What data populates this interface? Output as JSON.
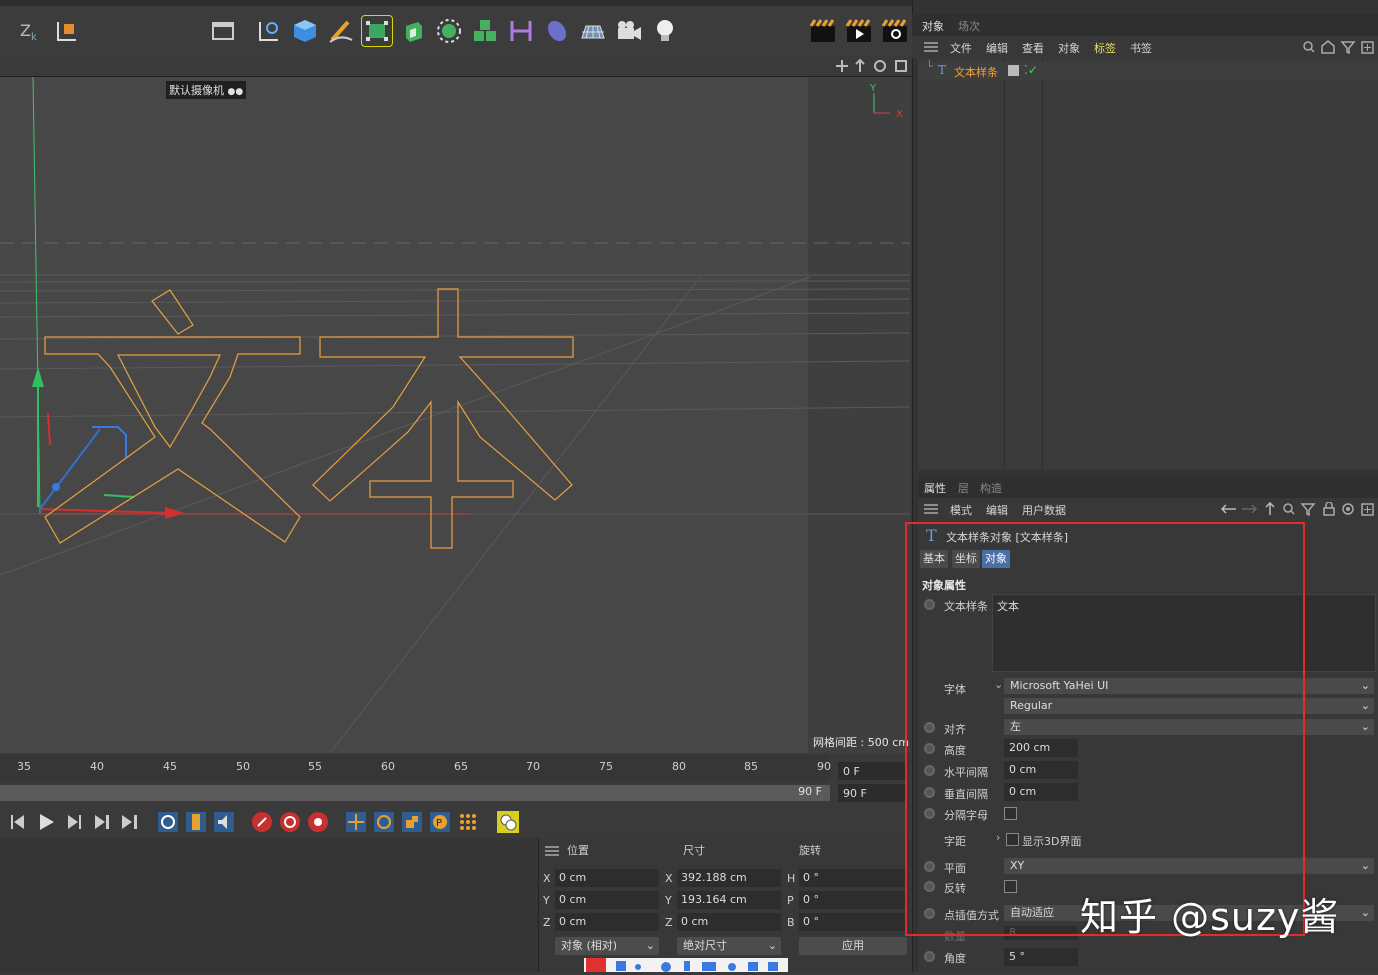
{
  "viewport": {
    "camera_label": "默认摄像机",
    "grid_spacing": "网格间距 : 500 cm",
    "axis_y": "Y",
    "axis_x": "X",
    "spline_text": "文本"
  },
  "timeline": {
    "ticks": [
      "35",
      "40",
      "45",
      "50",
      "55",
      "60",
      "65",
      "70",
      "75",
      "80",
      "85",
      "90"
    ],
    "current_frame": "0 F",
    "end_frame": "90 F",
    "end_field": "90 F",
    "scrub_end_label": "90 F"
  },
  "coords": {
    "headers": {
      "position": "位置",
      "size": "尺寸",
      "rotation": "旋转"
    },
    "rows": [
      {
        "axis": "X",
        "pos": "0 cm",
        "size_axis": "X",
        "size": "392.188 cm",
        "rot_axis": "H",
        "rot": "0 °"
      },
      {
        "axis": "Y",
        "pos": "0 cm",
        "size_axis": "Y",
        "size": "193.164 cm",
        "rot_axis": "P",
        "rot": "0 °"
      },
      {
        "axis": "Z",
        "pos": "0 cm",
        "size_axis": "Z",
        "size": "0 cm",
        "rot_axis": "B",
        "rot": "0 °"
      }
    ],
    "mode_dropdown": "对象 (相对)",
    "size_dropdown": "绝对尺寸",
    "apply_button": "应用"
  },
  "object_manager": {
    "tabs": [
      "对象",
      "场次"
    ],
    "menu": [
      "文件",
      "编辑",
      "查看",
      "对象",
      "标签",
      "书签"
    ],
    "items": [
      {
        "name": "文本样条"
      }
    ]
  },
  "attributes": {
    "tabs": [
      "属性",
      "层",
      "构造"
    ],
    "menu": [
      "模式",
      "编辑",
      "用户数据"
    ],
    "object_title": "文本样条对象 [文本样条]",
    "sub_tabs": [
      "基本",
      "坐标",
      "对象"
    ],
    "section_title": "对象属性",
    "text_label": "文本样条",
    "text_value": "文本",
    "font_label": "字体",
    "font_value": "Microsoft YaHei UI",
    "font_style": "Regular",
    "align_label": "对齐",
    "align_value": "左",
    "height_label": "高度",
    "height_value": "200 cm",
    "hspacing_label": "水平间隔",
    "hspacing_value": "0 cm",
    "vspacing_label": "垂直间隔",
    "vspacing_value": "0 cm",
    "separate_label": "分隔字母",
    "kerning_label": "字距",
    "show3d_label": "显示3D界面",
    "plane_label": "平面",
    "plane_value": "XY",
    "reverse_label": "反转",
    "interp_label": "点插值方式",
    "interp_value": "自动适应",
    "count_label": "数量",
    "count_value": "8",
    "angle_label": "角度",
    "angle_value": "5 °"
  },
  "watermark": "知乎 @suzy酱",
  "colors": {
    "spline_orange": "#e8a040",
    "highlight_red": "#e42a2a",
    "tab_active_blue": "#4a6fa5",
    "tag_yellow": "#e8e060"
  }
}
